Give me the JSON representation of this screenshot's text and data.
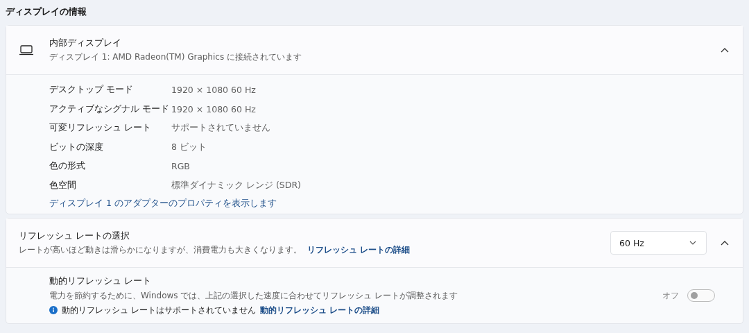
{
  "section_title": "ディスプレイの情報",
  "display_card": {
    "title": "内部ディスプレイ",
    "subtitle": "ディスプレイ 1: AMD Radeon(TM) Graphics に接続されています",
    "expanded": true,
    "properties": [
      {
        "label": "デスクトップ モード",
        "value": "1920 × 1080 60 Hz"
      },
      {
        "label": "アクティブなシグナル モード",
        "value": "1920 × 1080 60 Hz"
      },
      {
        "label": "可変リフレッシュ レート",
        "value": "サポートされていません"
      },
      {
        "label": "ビットの深度",
        "value": "8 ビット"
      },
      {
        "label": "色の形式",
        "value": "RGB"
      },
      {
        "label": "色空間",
        "value": "標準ダイナミック レンジ (SDR)"
      }
    ],
    "link": "ディスプレイ 1 のアダプターのプロパティを表示します"
  },
  "refresh_card": {
    "title": "リフレッシュ レートの選択",
    "description": "レートが高いほど動きは滑らかになりますが、消費電力も大きくなります。",
    "link": "リフレッシュ レートの詳細",
    "dropdown": {
      "value": "60 Hz"
    },
    "expanded": true,
    "dynamic": {
      "title": "動的リフレッシュ レート",
      "description": "電力を節約するために、Windows では、上記の選択した速度に合わせてリフレッシュ レートが調整されます",
      "info": "動的リフレッシュ レートはサポートされていません",
      "link": "動的リフレッシュ レートの詳細",
      "toggle_label": "オフ",
      "on": false
    }
  }
}
